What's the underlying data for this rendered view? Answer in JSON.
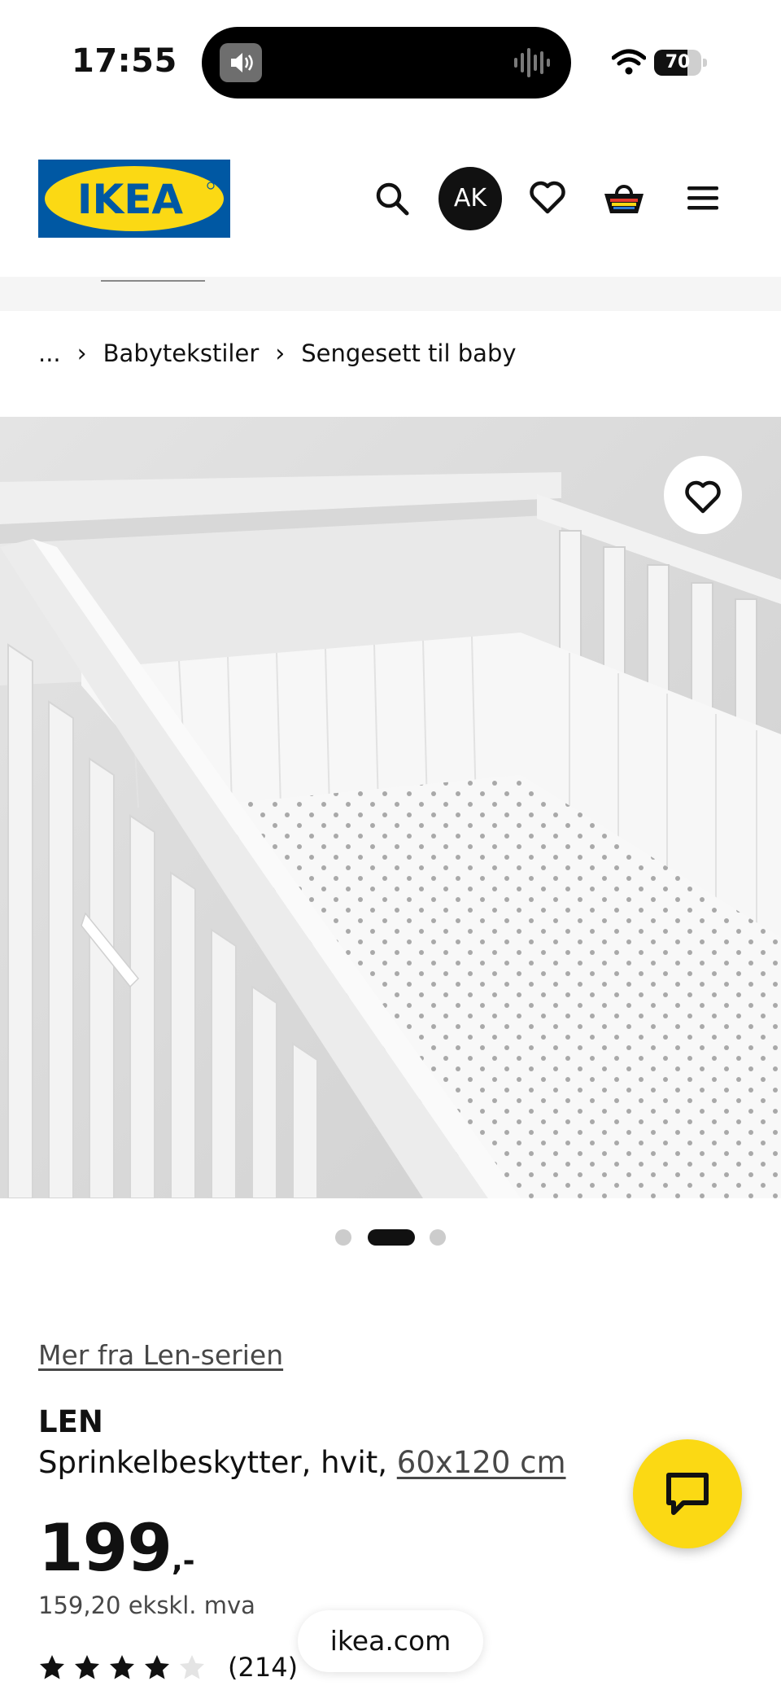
{
  "status_bar": {
    "time": "17:55",
    "battery": "70",
    "battery_fraction": 0.7
  },
  "header": {
    "logo_text": "IKEA",
    "avatar_initials": "AK",
    "icons": [
      "search-icon",
      "heart-icon",
      "basket-icon",
      "menu-icon"
    ]
  },
  "breadcrumb": {
    "ellipsis": "...",
    "items": [
      "Babytekstiler",
      "Sengesett til baby"
    ]
  },
  "carousel": {
    "count": 3,
    "active_index": 1
  },
  "product": {
    "series_link": "Mer fra Len-serien",
    "name": "LEN",
    "description": "Sprinkelbeskytter, hvit,",
    "size_link": "60x120 cm",
    "price_integer": "199",
    "price_decimal": ",-",
    "price_ex_vat": "159,20 ekskl. mva",
    "rating": 4,
    "rating_max": 5,
    "review_count": "(214)"
  },
  "browser": {
    "url": "ikea.com"
  },
  "colors": {
    "ikea_blue": "#0058a3",
    "ikea_yellow": "#fbd914",
    "text": "#111111",
    "muted": "#484848"
  }
}
